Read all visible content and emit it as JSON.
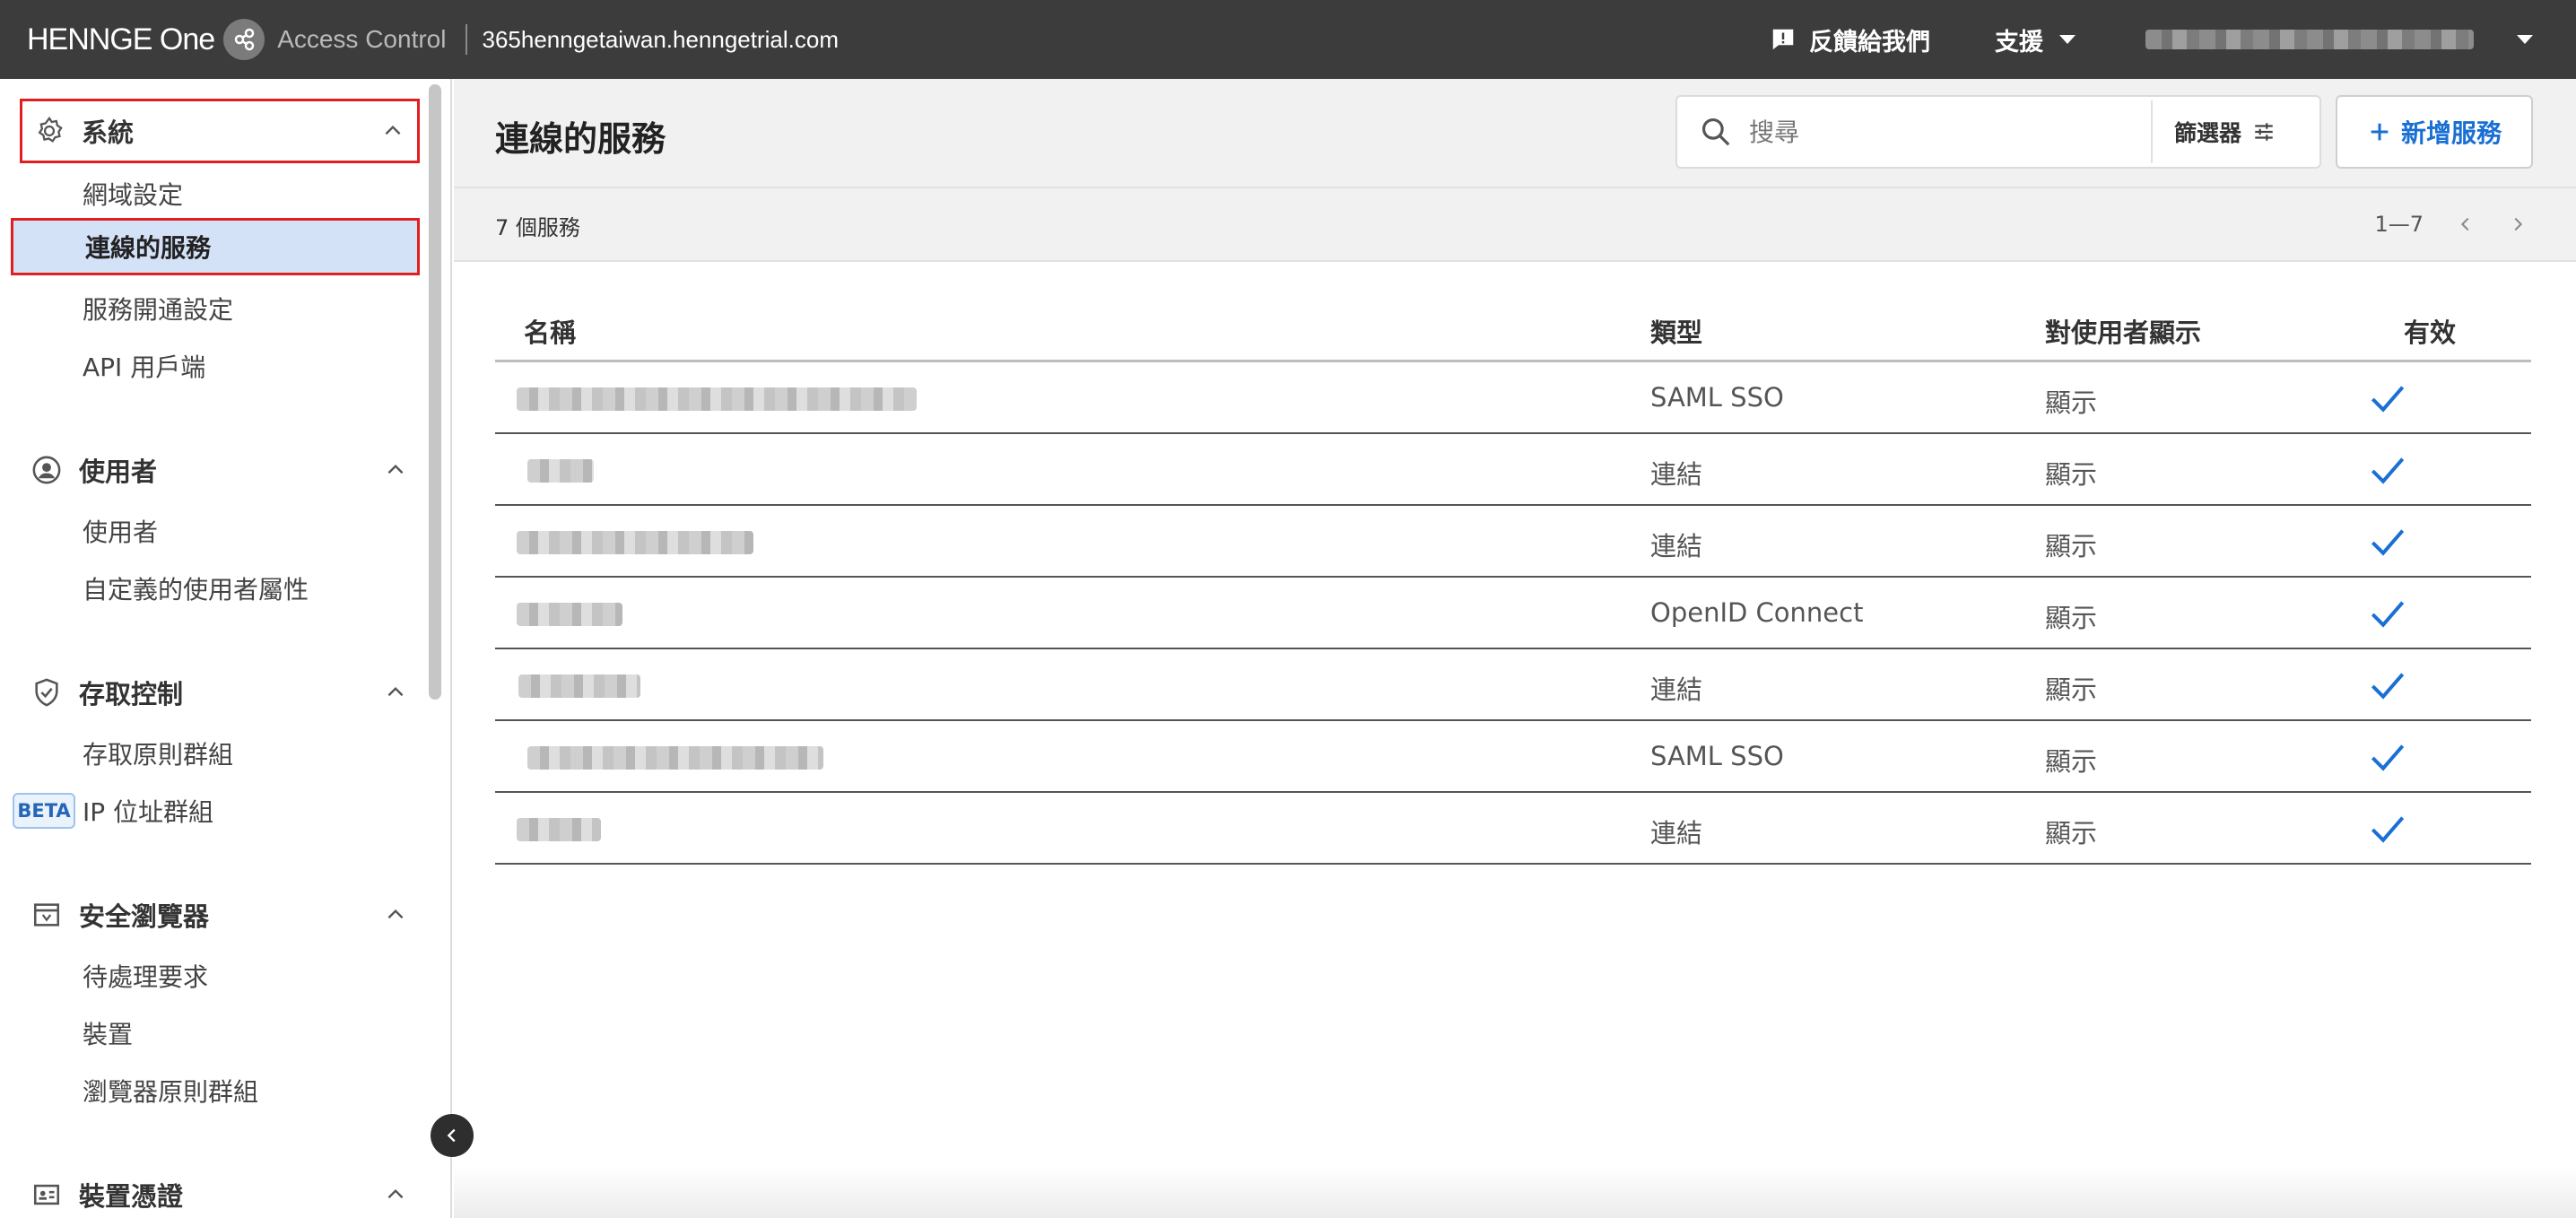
{
  "topbar": {
    "brand": "HENNGE One",
    "product": "Access Control",
    "domain": "365henngetaiwan.henngetrial.com",
    "feedback_label": "反饋給我們",
    "support_label": "支援",
    "user_name_blurred": ""
  },
  "sidebar": {
    "groups": [
      {
        "label": "系統",
        "icon": "gear-icon",
        "items": [
          "網域設定",
          "連線的服務",
          "服務開通設定",
          "API 用戶端"
        ]
      },
      {
        "label": "使用者",
        "icon": "user-circle-icon",
        "items": [
          "使用者",
          "自定義的使用者屬性"
        ]
      },
      {
        "label": "存取控制",
        "icon": "shield-check-icon",
        "items": [
          "存取原則群組",
          "IP 位址群組"
        ]
      },
      {
        "label": "安全瀏覽器",
        "icon": "browser-window-icon",
        "items": [
          "待處理要求",
          "裝置",
          "瀏覽器原則群組"
        ]
      },
      {
        "label": "裝置憑證",
        "icon": "id-card-icon",
        "items": []
      }
    ],
    "active_item": "連線的服務",
    "beta_badge": "BETA"
  },
  "main": {
    "title": "連線的服務",
    "search_placeholder": "搜尋",
    "filter_label": "篩選器",
    "add_button": "新增服務",
    "count_label": "7 個服務",
    "pagination": "1—7"
  },
  "table": {
    "columns": [
      "名稱",
      "類型",
      "對使用者顯示",
      "有效"
    ],
    "rows": [
      {
        "name": "",
        "type": "SAML SSO",
        "visible": "顯示",
        "enabled": true
      },
      {
        "name": "",
        "type": "連結",
        "visible": "顯示",
        "enabled": true
      },
      {
        "name": "",
        "type": "連結",
        "visible": "顯示",
        "enabled": true
      },
      {
        "name": "",
        "type": "OpenID Connect",
        "visible": "顯示",
        "enabled": true
      },
      {
        "name": "",
        "type": "連結",
        "visible": "顯示",
        "enabled": true
      },
      {
        "name": "",
        "type": "SAML SSO",
        "visible": "顯示",
        "enabled": true
      },
      {
        "name": "",
        "type": "連結",
        "visible": "顯示",
        "enabled": true
      }
    ]
  },
  "colors": {
    "topbar_bg": "#3c3c3c",
    "accent_blue": "#1a6fd4",
    "active_item_bg": "#d4e2f8",
    "highlight_red": "#e02020"
  }
}
